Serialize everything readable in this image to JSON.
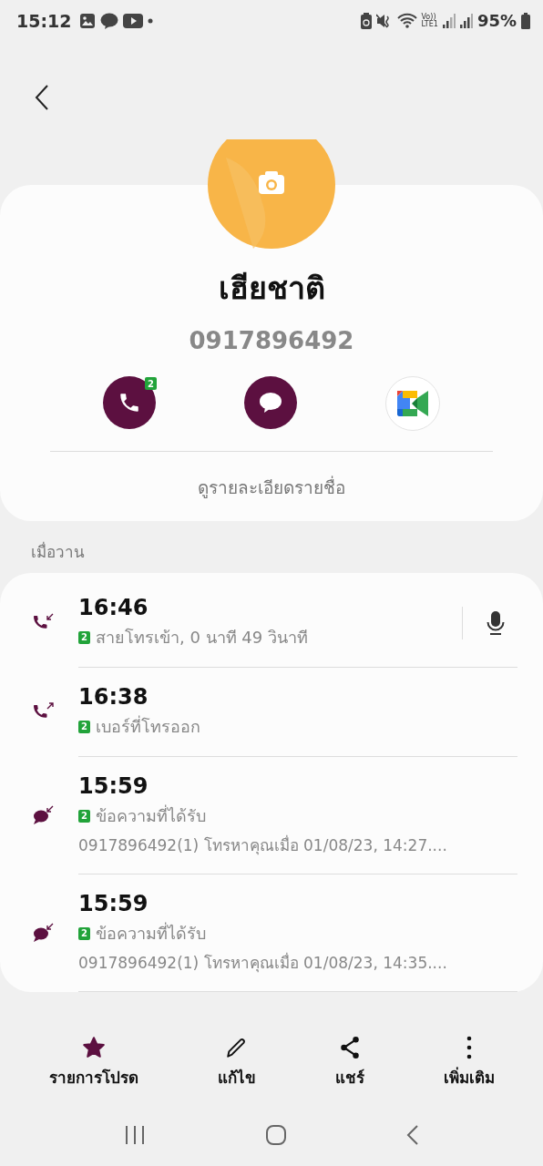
{
  "status_bar": {
    "time": "15:12",
    "volte": "Vo))",
    "network": "LTE1",
    "battery": "95%"
  },
  "contact": {
    "name": "เฮียชาติ",
    "number": "0917896492",
    "call_sim": "2",
    "details_link": "ดูรายละเอียดรายชื่อ"
  },
  "section_title": "เมื่อวาน",
  "log": [
    {
      "kind": "incoming_call",
      "time": "16:46",
      "sim": "2",
      "detail": "สายโทรเข้า, 0 นาที 49 วินาที",
      "has_recording": true
    },
    {
      "kind": "outgoing_call",
      "time": "16:38",
      "sim": "2",
      "detail": "เบอร์ที่โทรออก",
      "has_recording": false
    },
    {
      "kind": "received_message",
      "time": "15:59",
      "sim": "2",
      "detail": "ข้อความที่ได้รับ",
      "preview": "0917896492(1) โทรหาคุณเมื่อ 01/08/23, 14:27....",
      "has_recording": false
    },
    {
      "kind": "received_message",
      "time": "15:59",
      "sim": "2",
      "detail": "ข้อความที่ได้รับ",
      "preview": "0917896492(1) โทรหาคุณเมื่อ 01/08/23, 14:35....",
      "has_recording": false
    }
  ],
  "actions": [
    {
      "kind": "favorite",
      "label": "รายการโปรด",
      "on": true
    },
    {
      "kind": "edit",
      "label": "แก้ไข",
      "on": false
    },
    {
      "kind": "share",
      "label": "แชร์",
      "on": false
    },
    {
      "kind": "more",
      "label": "เพิ่มเติม",
      "on": false
    }
  ]
}
